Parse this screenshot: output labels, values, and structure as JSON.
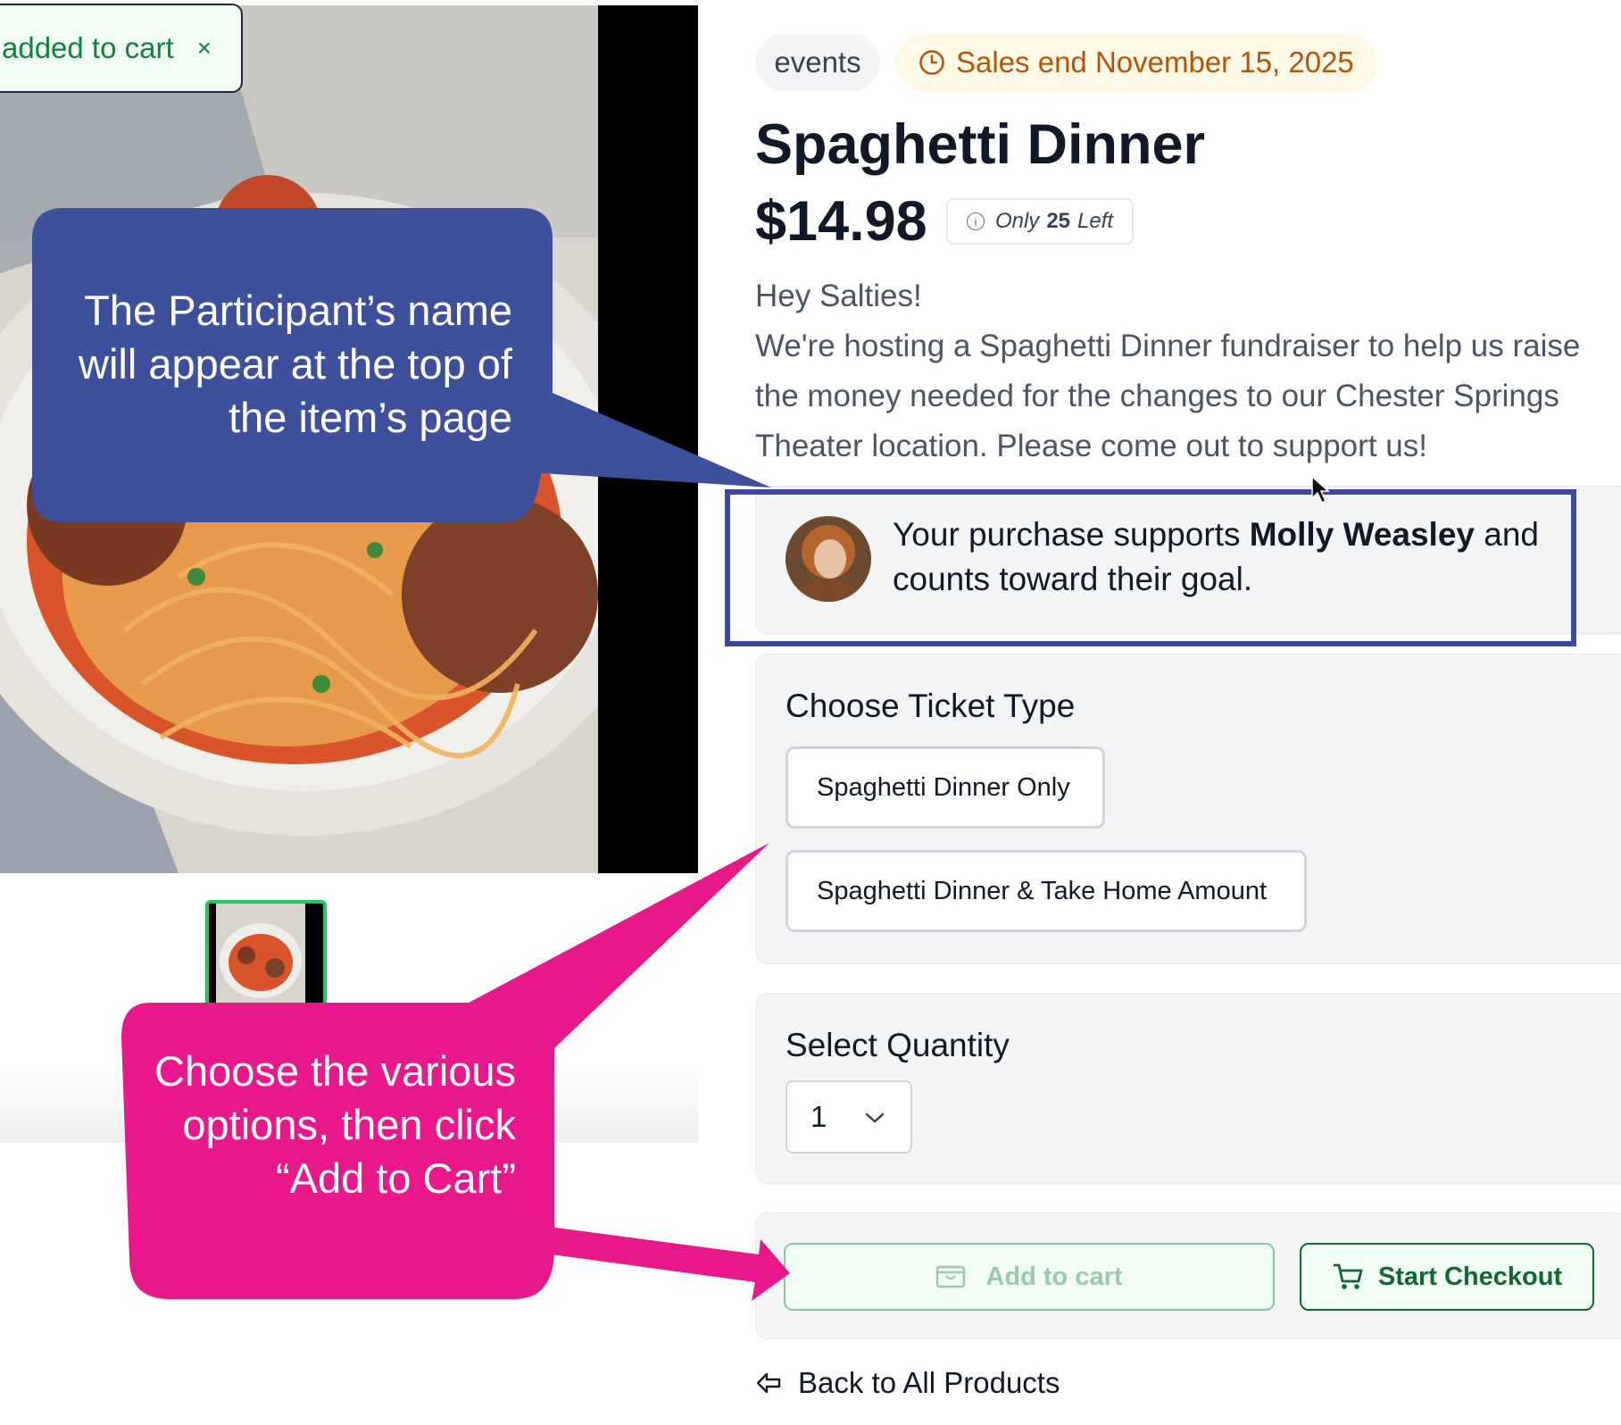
{
  "toast": {
    "message": "added to cart",
    "close": "×"
  },
  "product": {
    "category_tag": "events",
    "sales_notice": "Sales end November 15, 2025",
    "title": "Spaghetti Dinner",
    "price": "$14.98",
    "stock_prefix": "Only",
    "stock_count": "25",
    "stock_suffix": "Left",
    "description_lines": [
      "Hey Salties!",
      "We're hosting a Spaghetti Dinner fundraiser to help us raise the money needed for the changes to our Chester Springs Theater location. Please come out to support us!"
    ]
  },
  "supporter": {
    "prefix": "Your purchase supports",
    "name": "Molly Weasley",
    "suffix": "and counts toward their goal."
  },
  "ticket": {
    "heading": "Choose Ticket Type",
    "options": [
      "Spaghetti Dinner Only",
      "Spaghetti Dinner & Take Home Amount"
    ]
  },
  "quantity": {
    "heading": "Select Quantity",
    "value": "1"
  },
  "actions": {
    "add_to_cart": "Add to cart",
    "start_checkout": "Start Checkout"
  },
  "back_link": "Back to All Products",
  "annotations": {
    "blue": "The Participant’s name will appear at the top of the item’s page",
    "pink": "Choose the various options, then click “Add to Cart”"
  },
  "colors": {
    "callout_blue": "#3e4f9c",
    "callout_pink": "#e8178a",
    "accent_green": "#166534",
    "sales_text": "#b45309"
  },
  "icons": [
    "clock-icon",
    "info-icon",
    "chevron-down-icon",
    "cart-box-icon",
    "shopping-cart-icon",
    "back-arrow-icon",
    "close-icon"
  ]
}
